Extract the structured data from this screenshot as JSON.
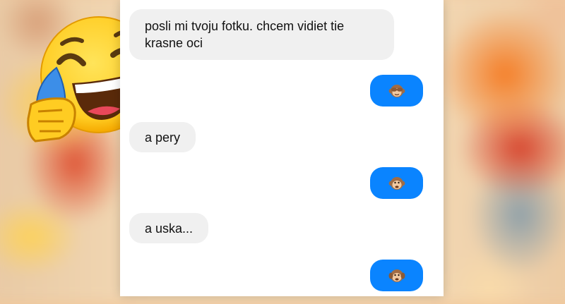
{
  "messages": [
    {
      "side": "incoming",
      "text": "posli mi tvoju fotku. chcem vidiet tie krasne oci"
    },
    {
      "side": "outgoing",
      "emoji": "see-no-evil-monkey"
    },
    {
      "side": "incoming",
      "text": "a pery"
    },
    {
      "side": "outgoing",
      "emoji": "monkey-face"
    },
    {
      "side": "incoming",
      "text": "a uska..."
    },
    {
      "side": "outgoing",
      "emoji": "hear-no-evil-monkey"
    }
  ],
  "colors": {
    "outgoing_bubble": "#0a84ff",
    "incoming_bubble": "#f0f0f0"
  },
  "decoration": {
    "overlay_emoji": "face-with-tears-of-joy"
  }
}
